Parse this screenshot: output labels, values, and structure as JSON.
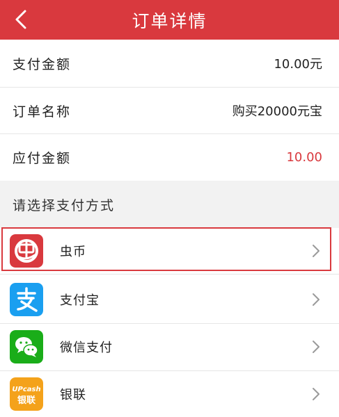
{
  "header": {
    "title": "订单详情"
  },
  "order": {
    "pay_amount_label": "支付金额",
    "pay_amount_value": "10.00元",
    "order_name_label": "订单名称",
    "order_name_value": "购买20000元宝",
    "due_amount_label": "应付金额",
    "due_amount_value": "10.00"
  },
  "payment": {
    "section_title": "请选择支付方式",
    "methods": [
      {
        "name": "虫币",
        "selected": true
      },
      {
        "name": "支付宝"
      },
      {
        "name": "微信支付"
      },
      {
        "name": "银联",
        "logo_text_top": "UPcash",
        "logo_text_bottom": "银联"
      }
    ]
  },
  "colors": {
    "brand_red": "#d9393e",
    "alipay_blue": "#1a9ff0",
    "wechat_green": "#1aad19",
    "unionpay_orange": "#f4a21b"
  }
}
